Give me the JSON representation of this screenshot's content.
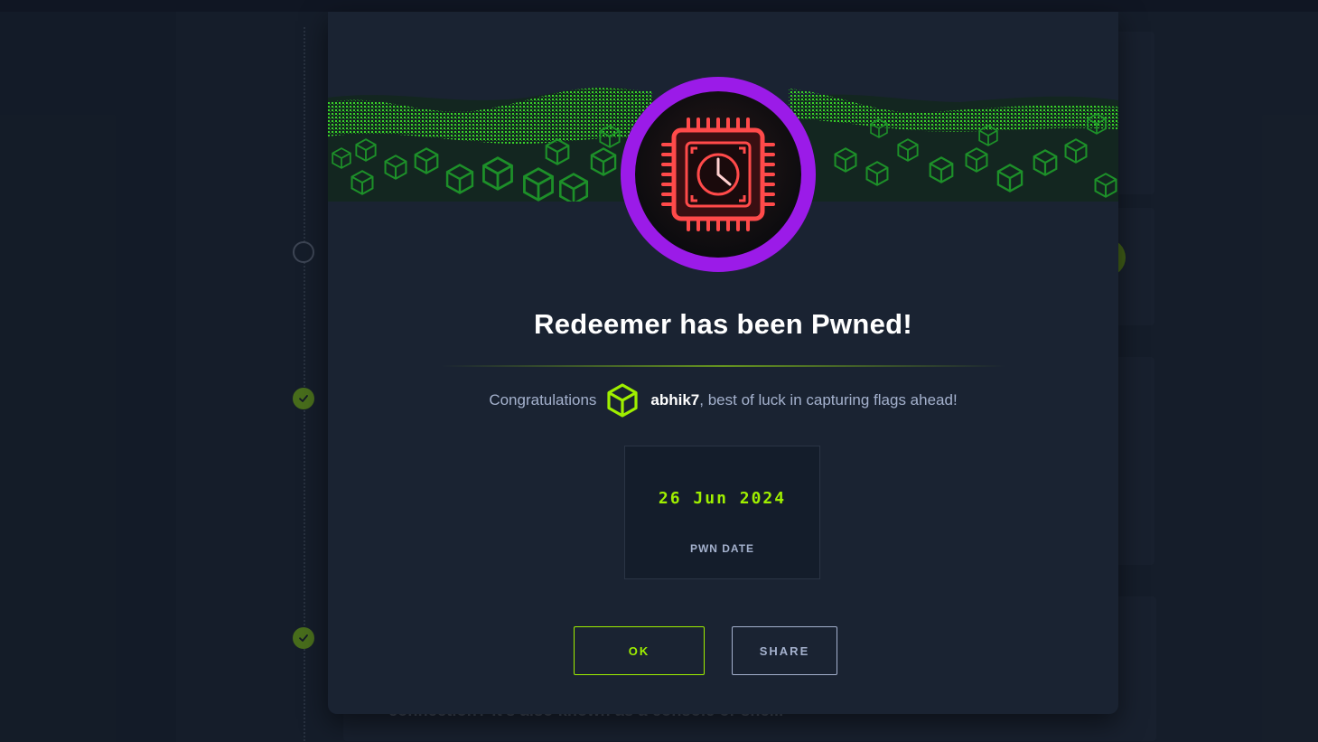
{
  "modal": {
    "title": "Redeemer has been Pwned!",
    "congrats_prefix": "Congratulations",
    "username": "abhik7",
    "congrats_suffix": ", best of luck in capturing flags ahead!",
    "pwn_date": "26 Jun 2024",
    "pwn_date_label": "PWN DATE",
    "ok_label": "OK",
    "share_label": "SHARE"
  },
  "background": {
    "partial_text": "connection? It's also known as a console or shell."
  },
  "icons": {
    "badge": "cpu-chip-clock-icon",
    "user": "hack-the-box-cube-icon",
    "timeline_done": "check-icon"
  },
  "colors": {
    "accent_green": "#9fef00",
    "badge_ring": "#9b1be8",
    "chip_red": "#ff4a4a",
    "text_muted": "#a4b1cd",
    "modal_bg": "#1a2332"
  }
}
